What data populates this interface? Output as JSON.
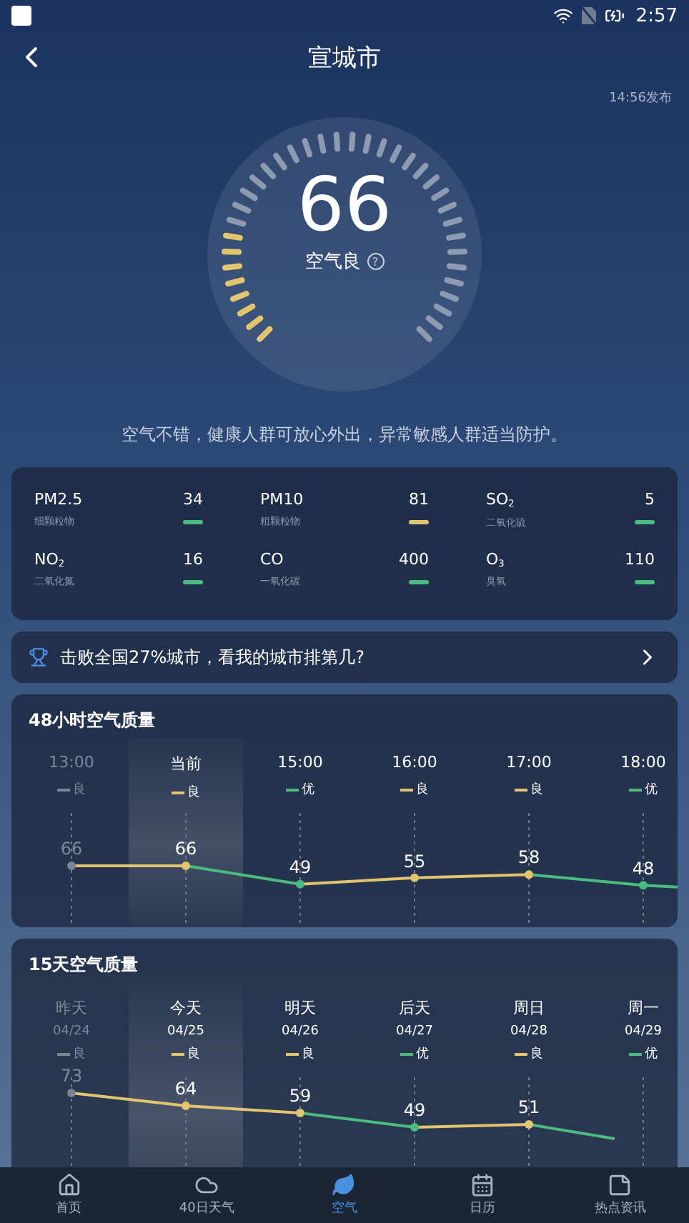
{
  "status_bar": {
    "time": "2:57"
  },
  "header": {
    "title": "宣城市",
    "published": "14:56发布"
  },
  "gauge": {
    "value": "66",
    "label": "空气良",
    "help": "?",
    "level": 0.16
  },
  "advice": "空气不错，健康人群可放心外出，异常敏感人群适当防护。",
  "pollutants": [
    {
      "name": "PM2.5",
      "desc": "细颗粒物",
      "value": "34",
      "color": "#4cbb7f"
    },
    {
      "name": "PM10",
      "desc": "粗颗粒物",
      "value": "81",
      "color": "#e3c56e"
    },
    {
      "name": "SO$_{2}$",
      "desc": "二氧化硫",
      "value": "5",
      "color": "#4cbb7f"
    },
    {
      "name": "NO$_{2}$",
      "desc": "二氧化氮",
      "value": "16",
      "color": "#4cbb7f"
    },
    {
      "name": "CO",
      "desc": "一氧化碳",
      "value": "400",
      "color": "#4cbb7f"
    },
    {
      "name": "O$_{3}$",
      "desc": "臭氧",
      "value": "110",
      "color": "#4cbb7f"
    }
  ],
  "rank_banner": {
    "text": "击败全国27%城市，看我的城市排第几?"
  },
  "hourly": {
    "title": "48小时空气质量",
    "items": [
      {
        "time": "13:00",
        "quality": "良",
        "aqi": "66",
        "color": "#7c8594",
        "past": true,
        "selected": false
      },
      {
        "time": "当前",
        "quality": "良",
        "aqi": "66",
        "color": "#e3c56e",
        "past": false,
        "selected": true
      },
      {
        "time": "15:00",
        "quality": "优",
        "aqi": "49",
        "color": "#4cbb7f",
        "past": false,
        "selected": false
      },
      {
        "time": "16:00",
        "quality": "良",
        "aqi": "55",
        "color": "#e3c56e",
        "past": false,
        "selected": false
      },
      {
        "time": "17:00",
        "quality": "良",
        "aqi": "58",
        "color": "#e3c56e",
        "past": false,
        "selected": false
      },
      {
        "time": "18:00",
        "quality": "优",
        "aqi": "48",
        "color": "#4cbb7f",
        "past": false,
        "selected": false
      }
    ]
  },
  "daily": {
    "title": "15天空气质量",
    "items": [
      {
        "day": "昨天",
        "date": "04/24",
        "quality": "良",
        "aqi": "73",
        "color": "#7c8594",
        "past": true,
        "selected": false
      },
      {
        "day": "今天",
        "date": "04/25",
        "quality": "良",
        "aqi": "64",
        "color": "#e3c56e",
        "past": false,
        "selected": true
      },
      {
        "day": "明天",
        "date": "04/26",
        "quality": "良",
        "aqi": "59",
        "color": "#e3c56e",
        "past": false,
        "selected": false
      },
      {
        "day": "后天",
        "date": "04/27",
        "quality": "优",
        "aqi": "49",
        "color": "#4cbb7f",
        "past": false,
        "selected": false
      },
      {
        "day": "周日",
        "date": "04/28",
        "quality": "良",
        "aqi": "51",
        "color": "#e3c56e",
        "past": false,
        "selected": false
      },
      {
        "day": "周一",
        "date": "04/29",
        "quality": "优",
        "color": "#4cbb7f",
        "past": false,
        "selected": false
      }
    ]
  },
  "nav": [
    {
      "label": "首页",
      "selected": false
    },
    {
      "label": "40日天气",
      "selected": false
    },
    {
      "label": "空气",
      "selected": true
    },
    {
      "label": "日历",
      "selected": false
    },
    {
      "label": "热点资讯",
      "selected": false
    }
  ]
}
